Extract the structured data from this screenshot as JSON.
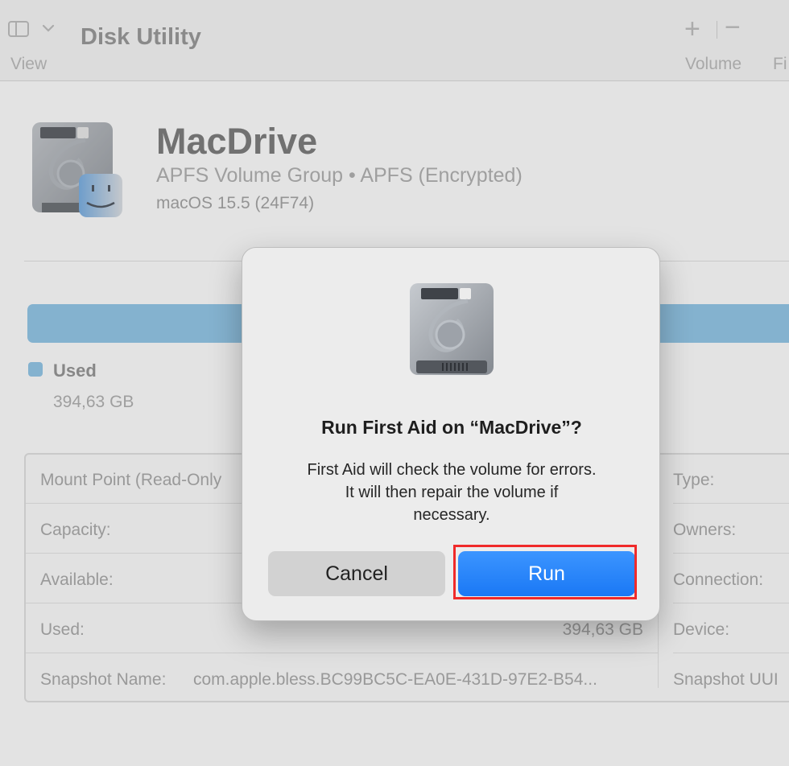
{
  "toolbar": {
    "view_label": "View",
    "title": "Disk Utility",
    "volume_label": "Volume",
    "fi_label": "Fi",
    "add_icon": "plus-icon",
    "remove_icon": "minus-icon",
    "sidebar_icon": "sidebar-toggle-icon"
  },
  "volume": {
    "name": "MacDrive",
    "subtitle": "APFS Volume Group • APFS (Encrypted)",
    "os": "macOS 15.5 (24F74)",
    "icon": "hard-drive-finder-icon"
  },
  "usage": {
    "legend_label": "Used",
    "legend_value": "394,63 GB",
    "color": "#86c0e6"
  },
  "info": {
    "left": [
      {
        "key": "Mount Point (Read-Only",
        "value": ""
      },
      {
        "key": "Capacity:",
        "value": ""
      },
      {
        "key": "Available:",
        "value": ""
      },
      {
        "key": "Used:",
        "value": "394,63 GB"
      },
      {
        "key": "Snapshot Name:",
        "value": "com.apple.bless.BC99BC5C-EA0E-431D-97E2-B54..."
      }
    ],
    "right": [
      {
        "key": "Type:"
      },
      {
        "key": "Owners:"
      },
      {
        "key": "Connection:"
      },
      {
        "key": "Device:"
      },
      {
        "key": "Snapshot UUI"
      }
    ]
  },
  "dialog": {
    "title": "Run First Aid on “MacDrive”?",
    "message_lines": [
      "First Aid will check the volume for errors.",
      "It will then repair the volume if",
      "necessary."
    ],
    "cancel_label": "Cancel",
    "run_label": "Run",
    "icon": "hard-drive-icon",
    "accent": "#1a78f5",
    "highlight_color": "#f02a2a"
  }
}
